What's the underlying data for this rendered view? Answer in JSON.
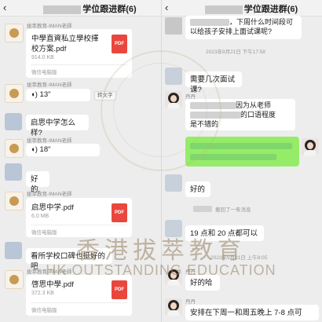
{
  "left": {
    "back_icon": "back-arrow-icon",
    "title": "学位跟进群(6)",
    "messages": {
      "m1_sender": "拔萃教育-IMAN老師",
      "m1_file_name": "中學直資私立學校擇校方案.pdf",
      "m1_file_size": "914.0 KB",
      "m1_source": "微信电脑版",
      "m2_sender": "拔萃教育-IMAN老師",
      "m2_voice": "13\"",
      "m2_tag": "转文字",
      "m3_text": "启思中学怎么样?",
      "m4_sender": "拔萃教育-IMAN老師",
      "m4_voice": "18\"",
      "m5_text": "好的.",
      "m6_sender": "拔萃教育-IMAN老師",
      "m6_file_name": "启思中学.pdf",
      "m6_file_size": "6.0 MB",
      "m6_source": "微信电脑版",
      "m7_text": "看所学校口碑也挺好的吧",
      "m8_sender": "拔萃教育-IMAN老師",
      "m8_file_name": "啓思中學.pdf",
      "m8_file_size": "372.3 KB",
      "m8_source": "微信电脑版",
      "pdf_label": "PDF"
    }
  },
  "right": {
    "back_icon": "back-arrow-icon",
    "title": "学位跟进群(6)",
    "messages": {
      "r1_text": "，下周什么时间段可以给孩子安排上面试课呢?",
      "r1_stamp": "2023年9月21日 下午17:58",
      "r2_text": "需要几次面试课?",
      "r3_sender": "丹丹",
      "r3_text_a": "因为从老师",
      "r3_text_b": "的口语程度",
      "r3_text_c": "是不错的",
      "r5_text": "好的",
      "r6_recall": "撤回了一条消息",
      "r7_text": "19 点和 20 点都可以",
      "r7_stamp": "2023年9月21日 上午8:05",
      "r8_sender": "丹丹",
      "r8_text": "好的哈",
      "r9_sender": "丹丹",
      "r9_text": "安排在下周一和周五晚上 7-8 点可"
    }
  },
  "watermark": {
    "cn": "香港拔萃教育",
    "en": "HK OUTSTANDING EDUCATION"
  }
}
